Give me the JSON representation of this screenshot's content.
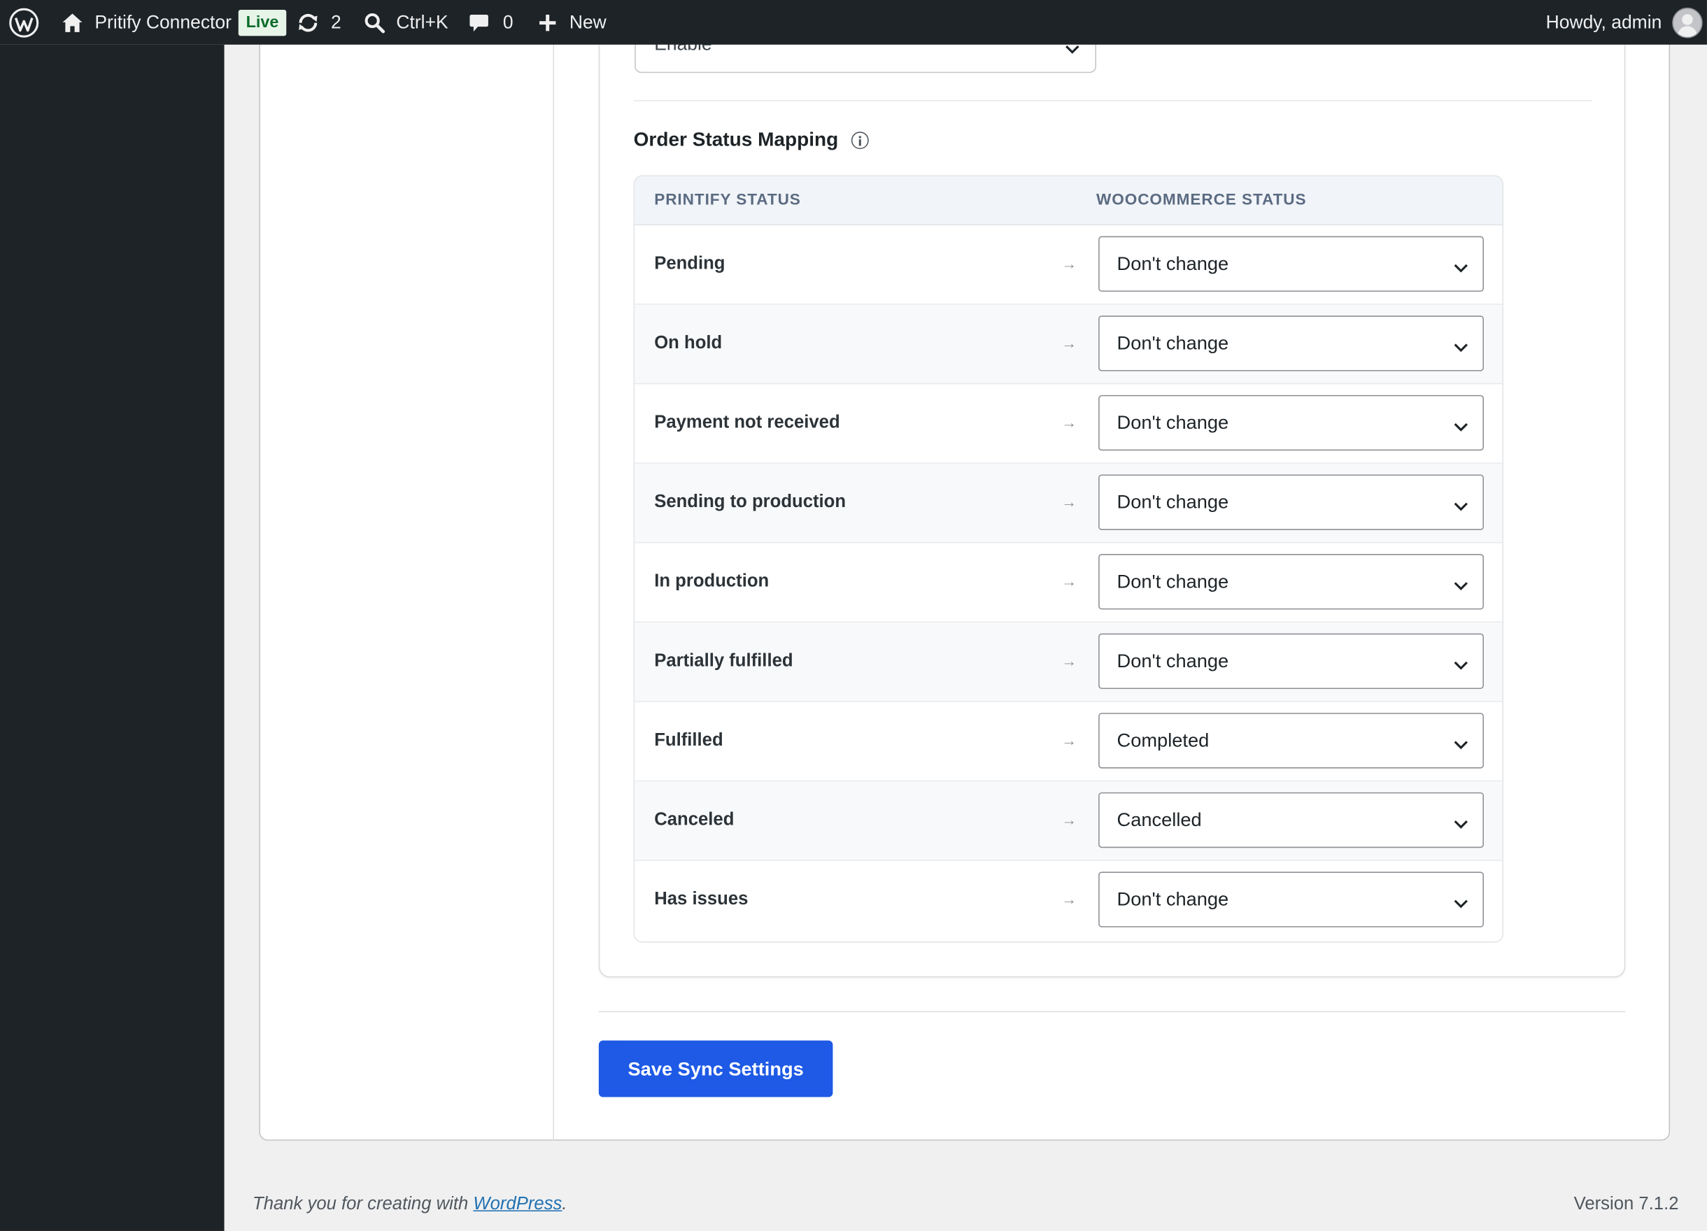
{
  "admin_bar": {
    "site_name": "Pritify Connector",
    "live_badge": "Live",
    "updates_count": "2",
    "search_shortcut": "Ctrl+K",
    "comments_count": "0",
    "new_label": "New",
    "howdy": "Howdy, admin"
  },
  "partial_field": {
    "value": "Enable"
  },
  "order_status_mapping": {
    "title": "Order Status Mapping",
    "col_printify": "PRINTIFY STATUS",
    "col_woocommerce": "WOOCOMMERCE STATUS",
    "arrow": "→",
    "rows": [
      {
        "printify": "Pending",
        "woocommerce": "Don't change"
      },
      {
        "printify": "On hold",
        "woocommerce": "Don't change"
      },
      {
        "printify": "Payment not received",
        "woocommerce": "Don't change"
      },
      {
        "printify": "Sending to production",
        "woocommerce": "Don't change"
      },
      {
        "printify": "In production",
        "woocommerce": "Don't change"
      },
      {
        "printify": "Partially fulfilled",
        "woocommerce": "Don't change"
      },
      {
        "printify": "Fulfilled",
        "woocommerce": "Completed"
      },
      {
        "printify": "Canceled",
        "woocommerce": "Cancelled"
      },
      {
        "printify": "Has issues",
        "woocommerce": "Don't change"
      }
    ]
  },
  "save_button": "Save Sync Settings",
  "footer": {
    "thanks_prefix": "Thank you for creating with ",
    "wordpress_link": "WordPress",
    "thanks_suffix": ".",
    "version": "Version 7.1.2"
  },
  "colors": {
    "admin_bar_bg": "#1d2327",
    "primary_button": "#1e5ae6",
    "live_badge_bg": "#e7f5e9"
  }
}
